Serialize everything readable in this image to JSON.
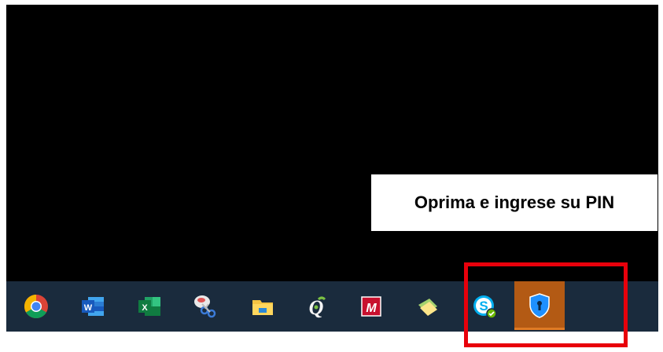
{
  "callout": {
    "text": "Oprima e ingrese su PIN"
  },
  "taskbar": {
    "icons": [
      {
        "name": "chrome-icon"
      },
      {
        "name": "word-icon",
        "letter": "W"
      },
      {
        "name": "excel-icon",
        "letter": "X"
      },
      {
        "name": "snipping-tool-icon"
      },
      {
        "name": "file-explorer-icon"
      },
      {
        "name": "qlik-icon",
        "letter": "Q"
      },
      {
        "name": "mcafee-icon",
        "letter": "M"
      },
      {
        "name": "sticky-notes-icon"
      },
      {
        "name": "skype-icon",
        "letter": "S"
      },
      {
        "name": "shield-pin-icon"
      }
    ]
  },
  "colors": {
    "taskbar": "#1a2b3d",
    "highlight_border": "#e8000b",
    "active_tile": "#b35a14"
  }
}
